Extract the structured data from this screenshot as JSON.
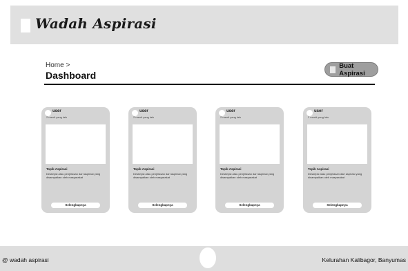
{
  "header": {
    "brand": "Wadah Aspirasi"
  },
  "breadcrumb": "Home >",
  "page_title": "Dashboard",
  "create_button_label": "Buat Aspirasi",
  "cards": [
    {
      "user": "user",
      "time": "2 menit yang lalu",
      "topic": "Topik Aspirasi",
      "description": "Deskripsi atau penjelasan dari aspirasi yang disampaikan oleh masyarakat",
      "more_label": "Selengkapnya"
    },
    {
      "user": "user",
      "time": "2 menit yang lalu",
      "topic": "Topik Aspirasi",
      "description": "Deskripsi atau penjelasan dari aspirasi yang disampaikan oleh masyarakat",
      "more_label": "Selengkapnya"
    },
    {
      "user": "user",
      "time": "2 menit yang lalu",
      "topic": "Topik Aspirasi",
      "description": "Deskripsi atau penjelasan dari aspirasi yang disampaikan oleh masyarakat",
      "more_label": "Selengkapnya"
    },
    {
      "user": "user",
      "time": "2 menit yang lalu",
      "topic": "Topik Aspirasi",
      "description": "Deskripsi atau penjelasan dari aspirasi yang disampaikan oleh masyarakat",
      "more_label": "Selengkapnya"
    }
  ],
  "footer": {
    "left": "@ wadah aspirasi",
    "right": "Kelurahan Kalibagor, Banyumas"
  },
  "colors": {
    "header_bg": "#e0e0e0",
    "card_bg": "#d4d4d4",
    "button_bg": "#9e9e9e",
    "footer_bg": "#dedede"
  }
}
